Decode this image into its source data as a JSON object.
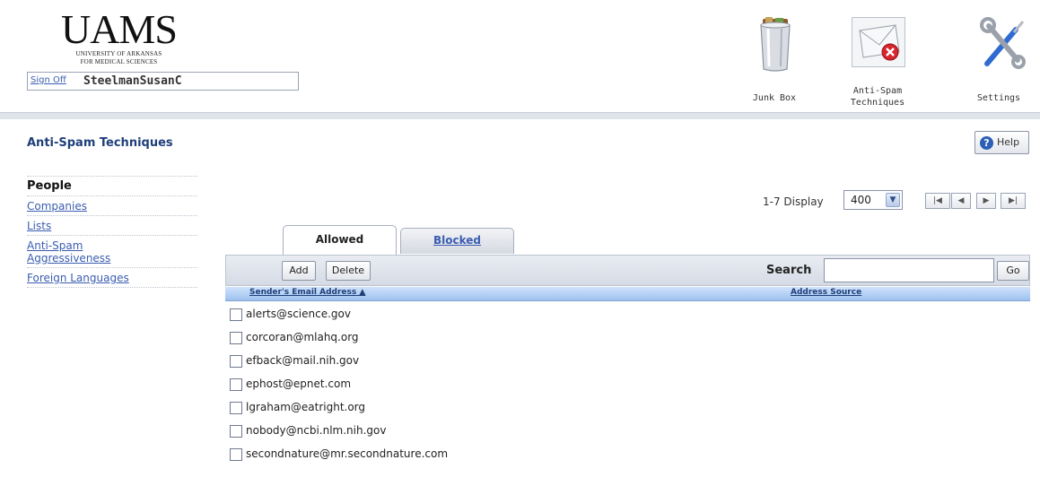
{
  "header": {
    "logo_word": "UAMS",
    "logo_line1": "UNIVERSITY OF ARKANSAS",
    "logo_line2": "FOR MEDICAL SCIENCES",
    "signoff_label": "Sign Off",
    "username": "SteelmanSusanC",
    "tools": [
      {
        "label": "Junk Box",
        "icon": "trash-can-icon"
      },
      {
        "label": "Anti-Spam Techniques",
        "icon": "envelope-block-icon"
      },
      {
        "label": "Settings",
        "icon": "wrench-screwdriver-icon"
      }
    ]
  },
  "page": {
    "title": "Anti-Spam Techniques",
    "help_label": "Help"
  },
  "sidebar": {
    "items": [
      {
        "label": "People",
        "active": true
      },
      {
        "label": "Companies",
        "active": false
      },
      {
        "label": "Lists",
        "active": false
      },
      {
        "label": "Anti-Spam Aggressiveness",
        "active": false
      },
      {
        "label": "Foreign Languages",
        "active": false
      }
    ]
  },
  "pager": {
    "info": "1-7 Display",
    "display_value": "400",
    "buttons": [
      "first-page-icon",
      "prev-page-icon",
      "next-page-icon",
      "last-page-icon"
    ]
  },
  "tabs": {
    "allowed": "Allowed",
    "blocked": "Blocked",
    "active": "allowed"
  },
  "toolbar": {
    "add_label": "Add",
    "delete_label": "Delete",
    "search_label": "Search",
    "search_value": "",
    "go_label": "Go"
  },
  "table": {
    "col_sender": "Sender's Email Address ▲",
    "col_source": "Address Source",
    "rows": [
      "alerts@science.gov",
      "corcoran@mlahq.org",
      "efback@mail.nih.gov",
      "ephost@epnet.com",
      "lgraham@eatright.org",
      "nobody@ncbi.nlm.nih.gov",
      "secondnature@mr.secondnature.com"
    ]
  },
  "colors": {
    "link": "#3a5db0",
    "title": "#1f3f7a",
    "header_band": "#dfe3ea",
    "column_header": "#9dc1ee"
  }
}
